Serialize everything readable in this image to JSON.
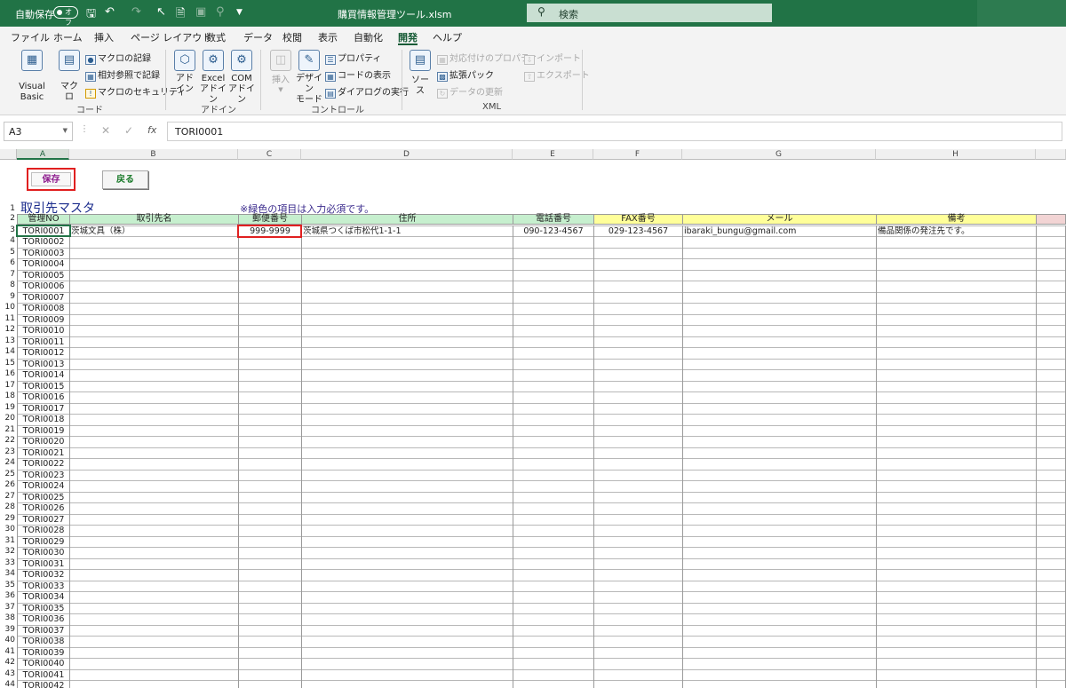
{
  "titlebar": {
    "autosave_label": "自動保存",
    "autosave_state": "オフ",
    "document_name": "購買情報管理ツール.xlsm",
    "search_placeholder": "検索"
  },
  "ribbon_tabs": [
    "ファイル",
    "ホーム",
    "挿入",
    "ページ レイアウト",
    "数式",
    "データ",
    "校閲",
    "表示",
    "自動化",
    "開発",
    "ヘルプ"
  ],
  "active_tab": "開発",
  "ribbon": {
    "code_group": {
      "label": "コード",
      "visual_basic": "Visual Basic",
      "macro": "マクロ",
      "record_macro": "マクロの記録",
      "relative_ref": "相対参照で記録",
      "macro_security": "マクロのセキュリティ"
    },
    "addin_group": {
      "label": "アドイン",
      "addin_l1": "アド",
      "addin_l2": "イン",
      "excel_addin_l1": "Excel",
      "excel_addin_l2": "アドイン",
      "com_addin_l1": "COM",
      "com_addin_l2": "アドイン"
    },
    "control_group": {
      "label": "コントロール",
      "insert": "挿入",
      "design_mode_l1": "デザイン",
      "design_mode_l2": "モード",
      "properties": "プロパティ",
      "view_code": "コードの表示",
      "run_dialog": "ダイアログの実行"
    },
    "xml_group": {
      "label": "XML",
      "source": "ソース",
      "map_properties": "対応付けのプロパティ",
      "expansion_packs": "拡張パック",
      "refresh_data": "データの更新",
      "import": "インポート",
      "export": "エクスポート"
    }
  },
  "formula_bar": {
    "name_box": "A3",
    "formula": "TORI0001"
  },
  "columns": [
    "A",
    "B",
    "C",
    "D",
    "E",
    "F",
    "G",
    "H"
  ],
  "sheet": {
    "save_button": "保存",
    "back_button": "戻る",
    "title": "取引先マスタ",
    "note": "※緑色の項目は入力必須です。",
    "headers": [
      "管理NO",
      "取引先名",
      "郵便番号",
      "住所",
      "電話番号",
      "FAX番号",
      "メール",
      "備考"
    ],
    "first_row": {
      "id": "TORI0001",
      "name": "茨城文具（株）",
      "postal": "999-9999",
      "address": "茨城県つくば市松代1-1-1",
      "phone": "090-123-4567",
      "fax": "029-123-4567",
      "email": "ibaraki_bungu@gmail.com",
      "memo": "備品関係の発注先です。"
    },
    "row_numbers": [
      "1",
      "2",
      "3",
      "4",
      "5",
      "6",
      "7",
      "8",
      "9",
      "10",
      "11",
      "12",
      "13",
      "14",
      "15",
      "16",
      "17",
      "18",
      "19",
      "20",
      "21",
      "22",
      "23",
      "24",
      "25",
      "26",
      "27",
      "28",
      "29",
      "30",
      "31",
      "32",
      "33",
      "34",
      "35",
      "36",
      "37",
      "38",
      "39",
      "40",
      "41",
      "42",
      "43",
      "44"
    ],
    "ids": [
      "TORI0002",
      "TORI0003",
      "TORI0004",
      "TORI0005",
      "TORI0006",
      "TORI0007",
      "TORI0008",
      "TORI0009",
      "TORI0010",
      "TORI0011",
      "TORI0012",
      "TORI0013",
      "TORI0014",
      "TORI0015",
      "TORI0016",
      "TORI0017",
      "TORI0018",
      "TORI0019",
      "TORI0020",
      "TORI0021",
      "TORI0022",
      "TORI0023",
      "TORI0024",
      "TORI0025",
      "TORI0026",
      "TORI0027",
      "TORI0028",
      "TORI0029",
      "TORI0030",
      "TORI0031",
      "TORI0032",
      "TORI0033",
      "TORI0034",
      "TORI0035",
      "TORI0036",
      "TORI0037",
      "TORI0038",
      "TORI0039",
      "TORI0040",
      "TORI0041",
      "TORI0042"
    ]
  },
  "colors": {
    "excel_green": "#217346",
    "required_header": "#c6efce",
    "optional_header": "#ffff99",
    "highlight_red": "#e02020"
  }
}
